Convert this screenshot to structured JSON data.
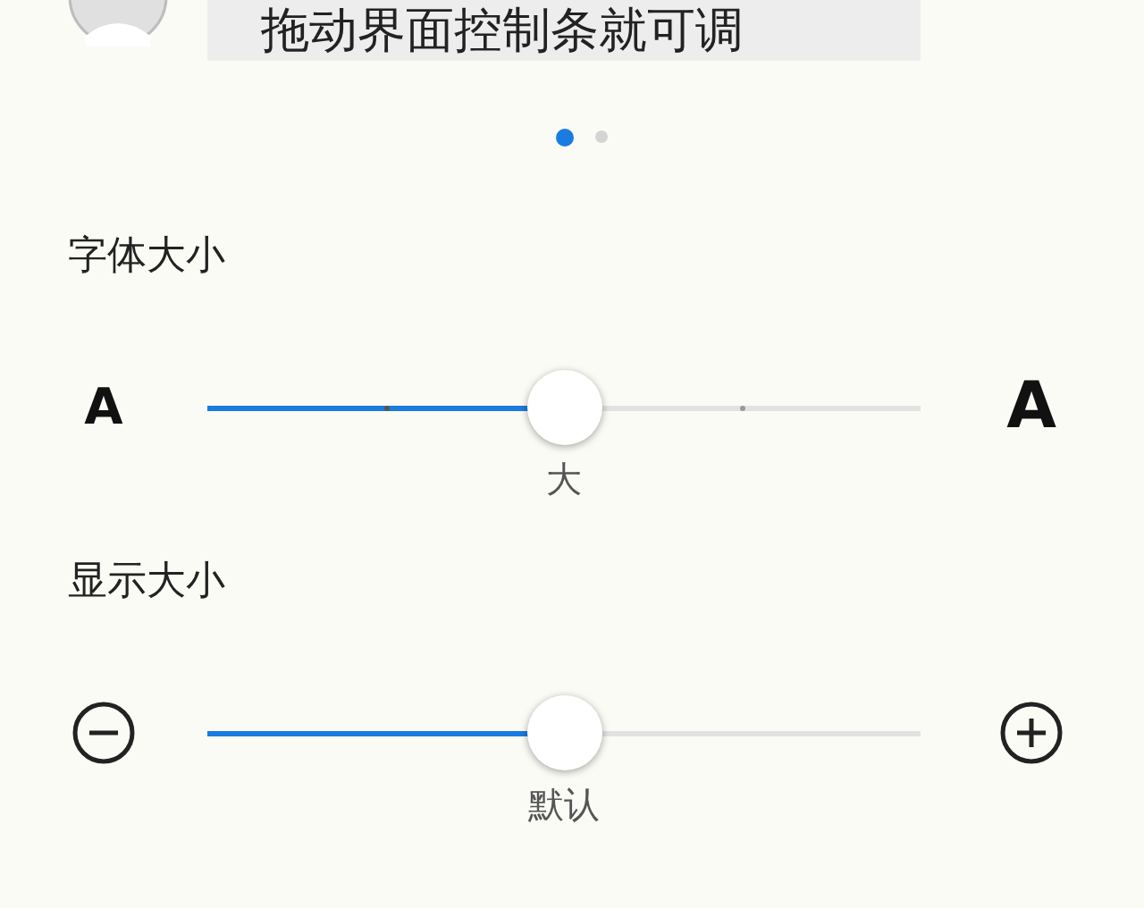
{
  "tip": {
    "text": "拖动界面控制条就可调"
  },
  "pages": [
    {
      "selected": true
    },
    {
      "selected": false
    }
  ],
  "settings": [
    {
      "kind": "font",
      "title": "字体大小",
      "level": 0.5,
      "reading": "大",
      "min_label": "A",
      "max_label": "A"
    },
    {
      "kind": "display",
      "title": "显示大小",
      "level": 0.5,
      "reading": "默认"
    }
  ]
}
